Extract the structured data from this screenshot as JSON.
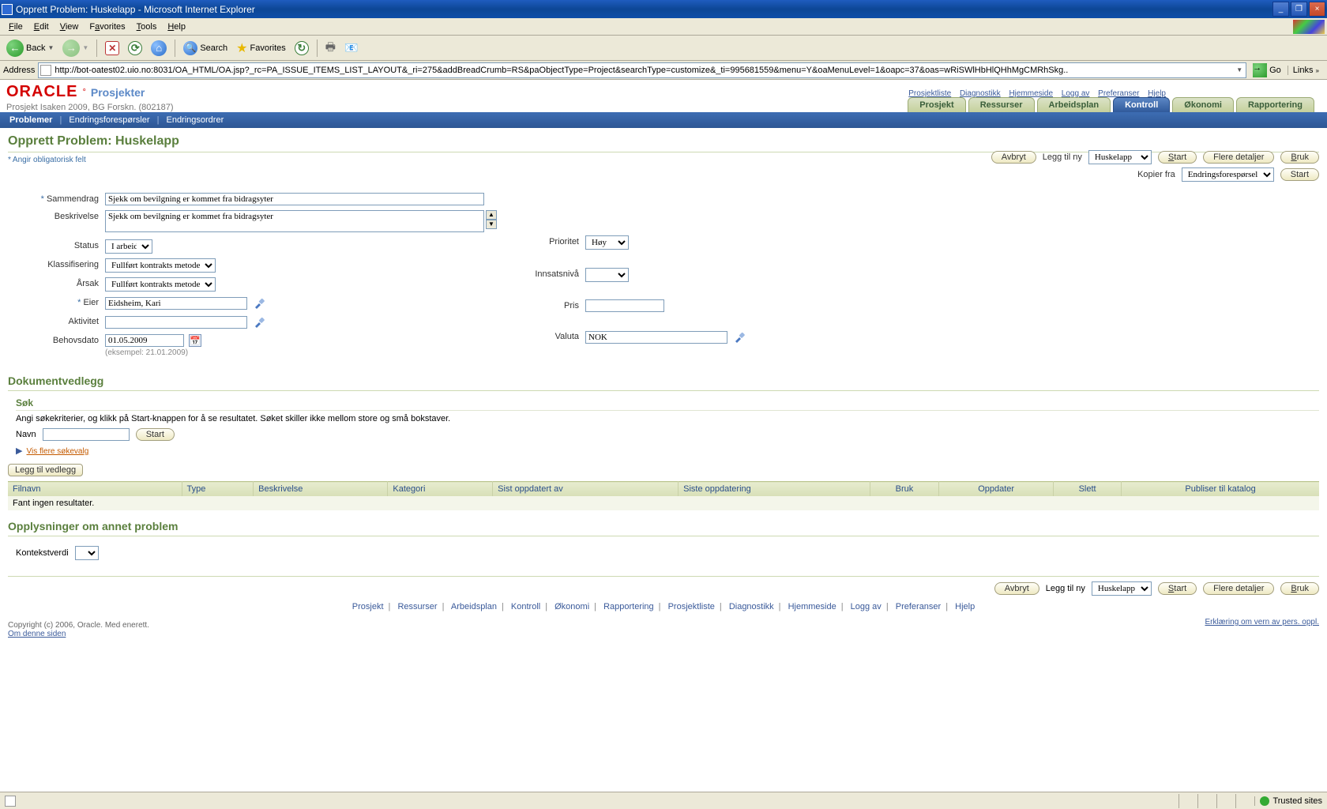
{
  "titlebar": {
    "title": "Opprett Problem: Huskelapp - Microsoft Internet Explorer",
    "min": "_",
    "max": "❐",
    "close": "×"
  },
  "ie_menu": {
    "file": "File",
    "edit": "Edit",
    "view": "View",
    "favorites": "Favorites",
    "tools": "Tools",
    "help": "Help"
  },
  "ie_toolbar": {
    "back": "Back",
    "search": "Search",
    "favorites": "Favorites"
  },
  "ie_addr": {
    "label": "Address",
    "url": "http://bot-oatest02.uio.no:8031/OA_HTML/OA.jsp?_rc=PA_ISSUE_ITEMS_LIST_LAYOUT&_ri=275&addBreadCrumb=RS&paObjectType=Project&searchType=customize&_ti=995681559&menu=Y&oaMenuLevel=1&oapc=37&oas=wRiSWlHbHlQHhMgCMRhSkg..",
    "go": "Go",
    "links": "Links"
  },
  "oracle": {
    "logo": "ORACLE",
    "app": "Prosjekter",
    "subtitle": "Prosjekt Isaken 2009, BG Forskn. (802187)"
  },
  "global_links": {
    "prosjektliste": "Prosjektliste",
    "diagnostikk": "Diagnostikk",
    "hjemmeside": "Hjemmeside",
    "loggav": "Logg av",
    "preferanser": "Preferanser",
    "hjelp": "Hjelp"
  },
  "tabs": {
    "prosjekt": "Prosjekt",
    "ressurser": "Ressurser",
    "arbeidsplan": "Arbeidsplan",
    "kontroll": "Kontroll",
    "okonomi": "Økonomi",
    "rapportering": "Rapportering"
  },
  "subnav": {
    "problemer": "Problemer",
    "endringsforesporsler": "Endringsforespørsler",
    "endringsordrer": "Endringsordrer"
  },
  "page_title": "Opprett Problem: Huskelapp",
  "req_note": "Angir obligatorisk felt",
  "action": {
    "avbryt": "Avbryt",
    "legg_til_ny": "Legg til ny",
    "huskelapp": "Huskelapp",
    "start": "Start",
    "flere_detaljer": "Flere detaljer",
    "bruk": "Bruk",
    "kopier_fra": "Kopier fra",
    "endringsforesporsel": "Endringsforespørsel",
    "start2": "Start"
  },
  "form": {
    "sammendrag": {
      "label": "Sammendrag",
      "value": "Sjekk om bevilgning er kommet fra bidragsyter"
    },
    "beskrivelse": {
      "label": "Beskrivelse",
      "value": "Sjekk om bevilgning er kommet fra bidragsyter"
    },
    "status": {
      "label": "Status",
      "value": "I arbeid"
    },
    "klassifisering": {
      "label": "Klassifisering",
      "value": "Fullført kontrakts metode"
    },
    "arsak": {
      "label": "Årsak",
      "value": "Fullført kontrakts metode"
    },
    "eier": {
      "label": "Eier",
      "value": "Eidsheim, Kari"
    },
    "aktivitet": {
      "label": "Aktivitet",
      "value": ""
    },
    "behovsdato": {
      "label": "Behovsdato",
      "value": "01.05.2009",
      "hint": "(eksempel: 21.01.2009)"
    },
    "prioritet": {
      "label": "Prioritet",
      "value": "Høy"
    },
    "innsatsniva": {
      "label": "Innsatsnivå",
      "value": ""
    },
    "pris": {
      "label": "Pris",
      "value": ""
    },
    "valuta": {
      "label": "Valuta",
      "value": "NOK"
    }
  },
  "section_dok": "Dokumentvedlegg",
  "section_sok": "Søk",
  "sok_hint": "Angi søkekriterier, og klikk på Start-knappen for å se resultatet. Søket skiller ikke mellom store og små bokstaver.",
  "sok_navn": "Navn",
  "sok_start": "Start",
  "more_search": "Vis flere søkevalg",
  "legg_til_vedlegg": "Legg til vedlegg",
  "table_headers": {
    "filnavn": "Filnavn",
    "type": "Type",
    "beskrivelse": "Beskrivelse",
    "kategori": "Kategori",
    "sist_oppdatert_av": "Sist oppdatert av",
    "siste_oppdatering": "Siste oppdatering",
    "bruk": "Bruk",
    "oppdater": "Oppdater",
    "slett": "Slett",
    "publiser": "Publiser til katalog"
  },
  "no_results": "Fant ingen resultater.",
  "section_annet": "Opplysninger om annet problem",
  "kontekstverdi": "Kontekstverdi",
  "footer_links": {
    "prosjekt": "Prosjekt",
    "ressurser": "Ressurser",
    "arbeidsplan": "Arbeidsplan",
    "kontroll": "Kontroll",
    "okonomi": "Økonomi",
    "rapportering": "Rapportering",
    "prosjektliste": "Prosjektliste",
    "diagnostikk": "Diagnostikk",
    "hjemmeside": "Hjemmeside",
    "loggav": "Logg av",
    "preferanser": "Preferanser",
    "hjelp": "Hjelp"
  },
  "copyright": "Copyright (c) 2006, Oracle. Med enerett.",
  "om_siden": "Om denne siden",
  "privacy": "Erklæring om vern av pers. oppl.",
  "statusbar": {
    "zone": "Trusted sites"
  }
}
